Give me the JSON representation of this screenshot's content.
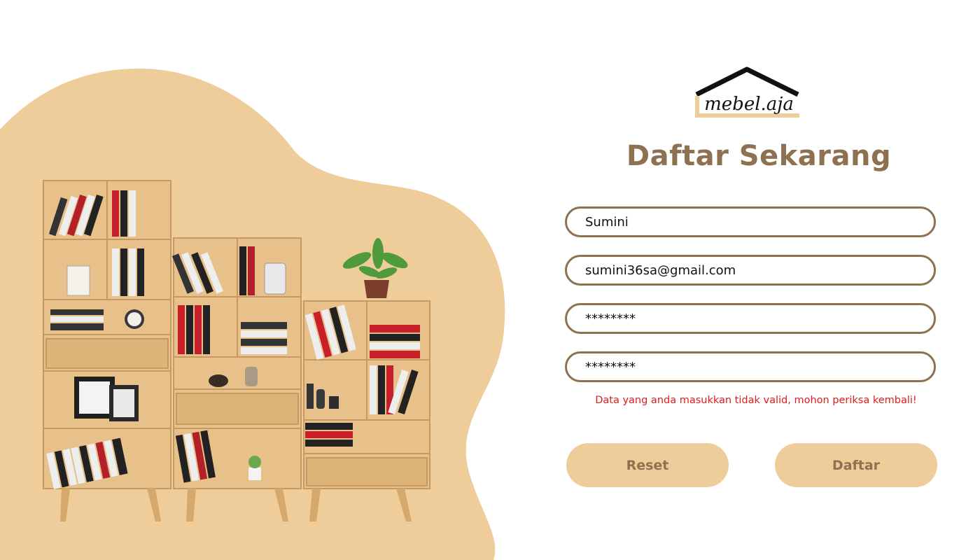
{
  "brand": {
    "logo_text": "mebel.aja"
  },
  "form": {
    "title": "Daftar Sekarang",
    "name_value": "Sumini",
    "email_value": "sumini36sa@gmail.com",
    "password_value": "********",
    "confirm_password_value": "********",
    "error_message": "Data yang anda masukkan tidak valid, mohon periksa kembali!",
    "reset_label": "Reset",
    "submit_label": "Daftar"
  },
  "colors": {
    "accent": "#8d7150",
    "blob": "#efcd9b",
    "error": "#e01b1b"
  }
}
